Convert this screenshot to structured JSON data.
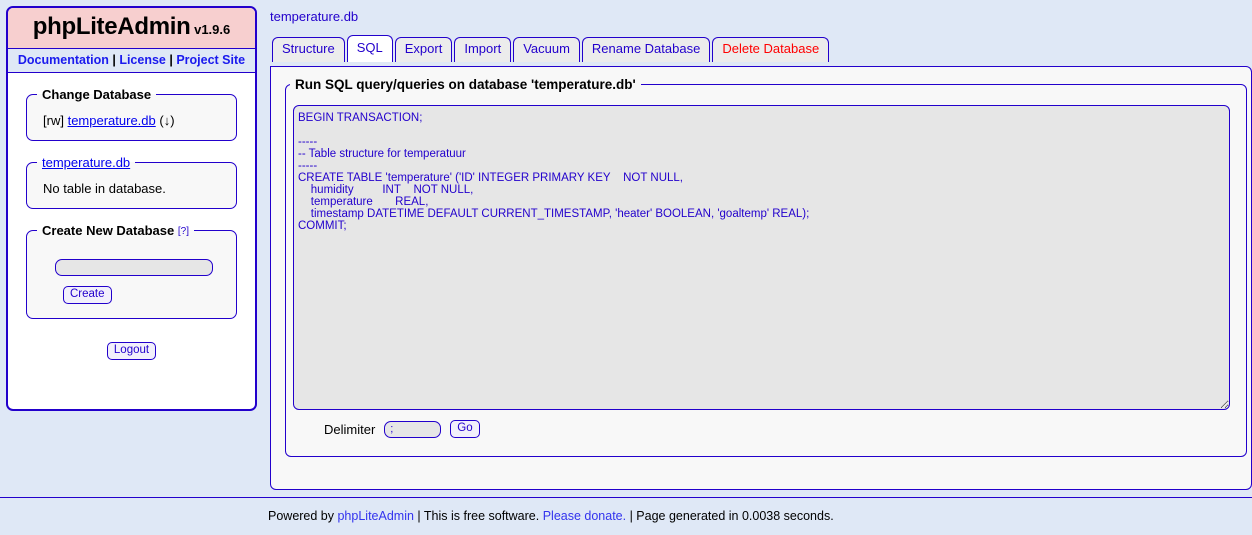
{
  "sidebar": {
    "brand_name": "phpLiteAdmin",
    "brand_version": "v1.9.6",
    "links": {
      "documentation": "Documentation",
      "separator": " | ",
      "license": "License",
      "project_site": "Project Site"
    },
    "change_database": {
      "legend": "Change Database",
      "permission": "[rw]",
      "db_name": "temperature.db",
      "download": "(↓)"
    },
    "current_database": {
      "legend": "temperature.db",
      "message": "No table in database."
    },
    "create_database": {
      "legend": "Create New Database",
      "help_marker": "[?]",
      "input_value": "",
      "input_placeholder": "",
      "create_label": "Create"
    },
    "logout_label": "Logout"
  },
  "main": {
    "breadcrumb": "temperature.db",
    "tabs": [
      {
        "label": "Structure",
        "active": false,
        "danger": false
      },
      {
        "label": "SQL",
        "active": true,
        "danger": false
      },
      {
        "label": "Export",
        "active": false,
        "danger": false
      },
      {
        "label": "Import",
        "active": false,
        "danger": false
      },
      {
        "label": "Vacuum",
        "active": false,
        "danger": false
      },
      {
        "label": "Rename Database",
        "active": false,
        "danger": false
      },
      {
        "label": "Delete Database",
        "active": false,
        "danger": true
      }
    ],
    "panel": {
      "legend": "Run SQL query/queries on database 'temperature.db'",
      "sql_value": "BEGIN TRANSACTION;\n\n-----\n-- Table structure for temperatuur\n-----\nCREATE TABLE 'temperature' ('ID' INTEGER PRIMARY KEY    NOT NULL,\n    humidity         INT    NOT NULL,\n    temperature       REAL,\n    timestamp DATETIME DEFAULT CURRENT_TIMESTAMP, 'heater' BOOLEAN, 'goaltemp' REAL);\nCOMMIT;",
      "delimiter_label": "Delimiter",
      "delimiter_value": ";",
      "go_label": "Go"
    }
  },
  "footer": {
    "powered_by": "Powered by ",
    "app_link": "phpLiteAdmin",
    "free_software": " | This is free software. ",
    "donate_link": "Please donate.",
    "generated": " | Page generated in 0.0038 seconds."
  },
  "colors": {
    "accent": "#2200cc",
    "brand_bg": "#f7cfcf",
    "link_bg": "#dfe8f6",
    "danger": "#ff0000",
    "page_bg": "#dfe8f6"
  }
}
